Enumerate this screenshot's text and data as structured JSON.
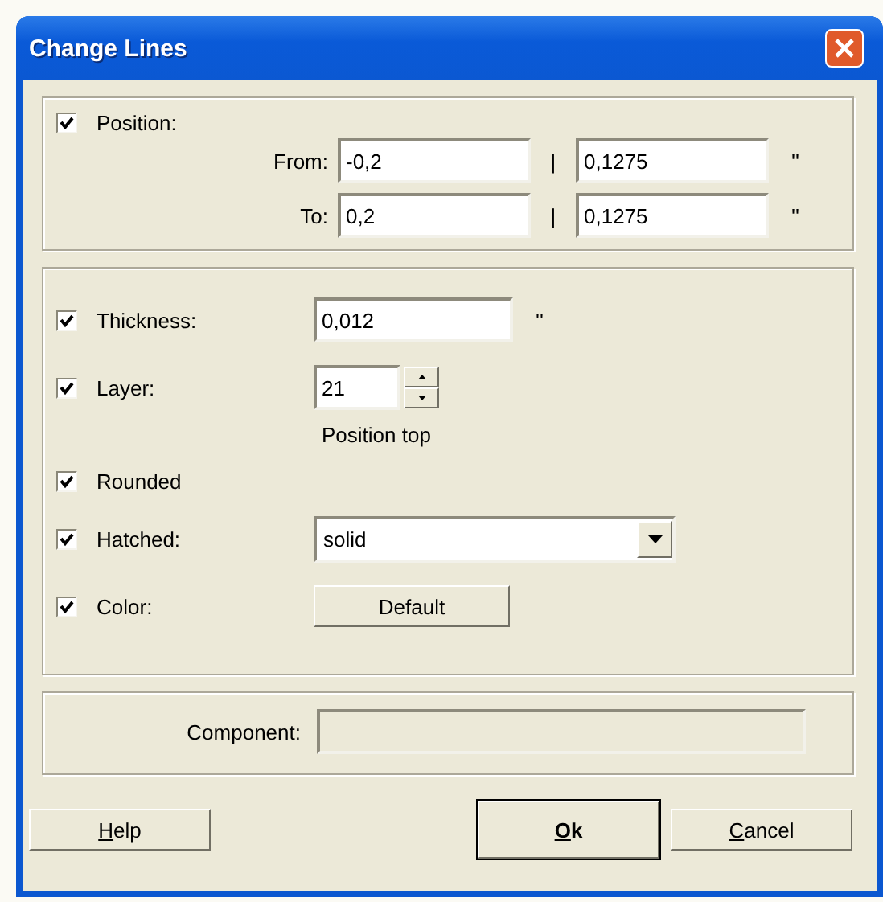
{
  "window": {
    "title": "Change Lines"
  },
  "position": {
    "label": "Position:",
    "checked": true,
    "rows": [
      {
        "label": "From:",
        "first": "-0,2",
        "separator": "|",
        "second": "0,1275",
        "unit": "''"
      },
      {
        "label": "To:",
        "first": "0,2",
        "separator": "|",
        "second": "0,1275",
        "unit": "''"
      }
    ]
  },
  "options": [
    {
      "kind": "text",
      "label": "Thickness:",
      "checked": true,
      "value": "0,012",
      "unit": "''"
    },
    {
      "kind": "spin",
      "label": "Layer:",
      "checked": true,
      "value": "21",
      "note": "Position top"
    },
    {
      "kind": "plain",
      "label": "Rounded",
      "checked": true
    },
    {
      "kind": "select",
      "label": "Hatched:",
      "checked": true,
      "value": "solid"
    },
    {
      "kind": "button",
      "label": "Color:",
      "checked": true,
      "button": "Default"
    }
  ],
  "component": {
    "label": "Component:",
    "disabled": true
  },
  "buttons": [
    {
      "label": "Help",
      "default": false,
      "mnemonic_first": true
    },
    {
      "label": "Ok",
      "default": true,
      "mnemonic_first": true
    },
    {
      "label": "Cancel",
      "default": false,
      "mnemonic_first": true
    }
  ]
}
